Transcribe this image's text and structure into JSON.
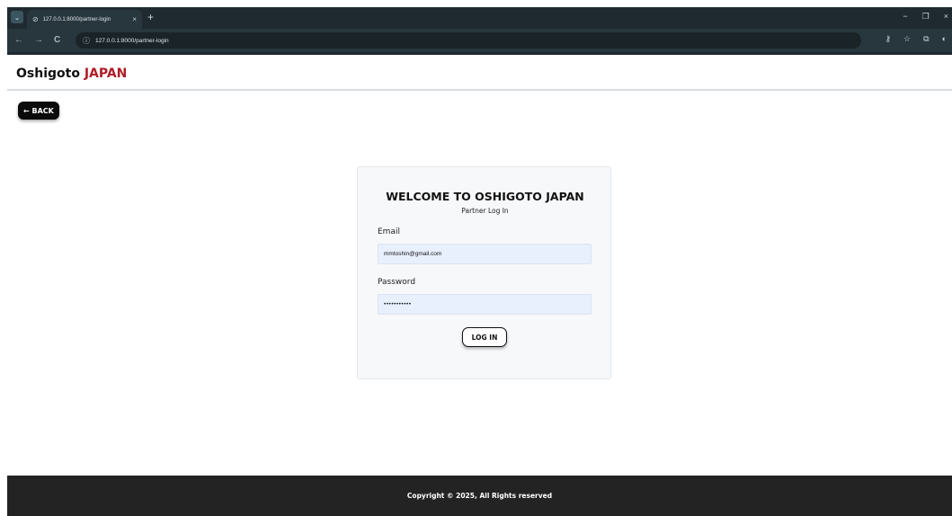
{
  "browser": {
    "tab_title": "127.0.0.1:8000/partner-login",
    "url": "127.0.0.1:8000/partner-login",
    "tab_close_glyph": "×",
    "new_tab_glyph": "+",
    "menu_glyph": "⌄",
    "back_glyph": "←",
    "forward_glyph": "→",
    "reload_glyph": "C",
    "info_glyph": "ⓘ",
    "window_controls": {
      "minimize": "−",
      "restore": "❐",
      "close": "×"
    },
    "toolbar_icons": {
      "password": "⚷",
      "bookmark": "☆",
      "extensions": "⧉",
      "profile": "◐"
    }
  },
  "header": {
    "brand_main": "Oshigoto",
    "brand_accent": "JAPAN",
    "accent_color": "#b01c26"
  },
  "back_button": {
    "label": "← BACK"
  },
  "login_card": {
    "title": "WELCOME TO OSHIGOTO JAPAN",
    "subtitle": "Partner Log In",
    "email_label": "Email",
    "email_value": "mmtoshin@gmail.com",
    "password_label": "Password",
    "password_value": "•••••••••••",
    "submit_label": "LOG IN"
  },
  "footer": {
    "copyright": "Copyright © 2025, All Rights reserved"
  }
}
